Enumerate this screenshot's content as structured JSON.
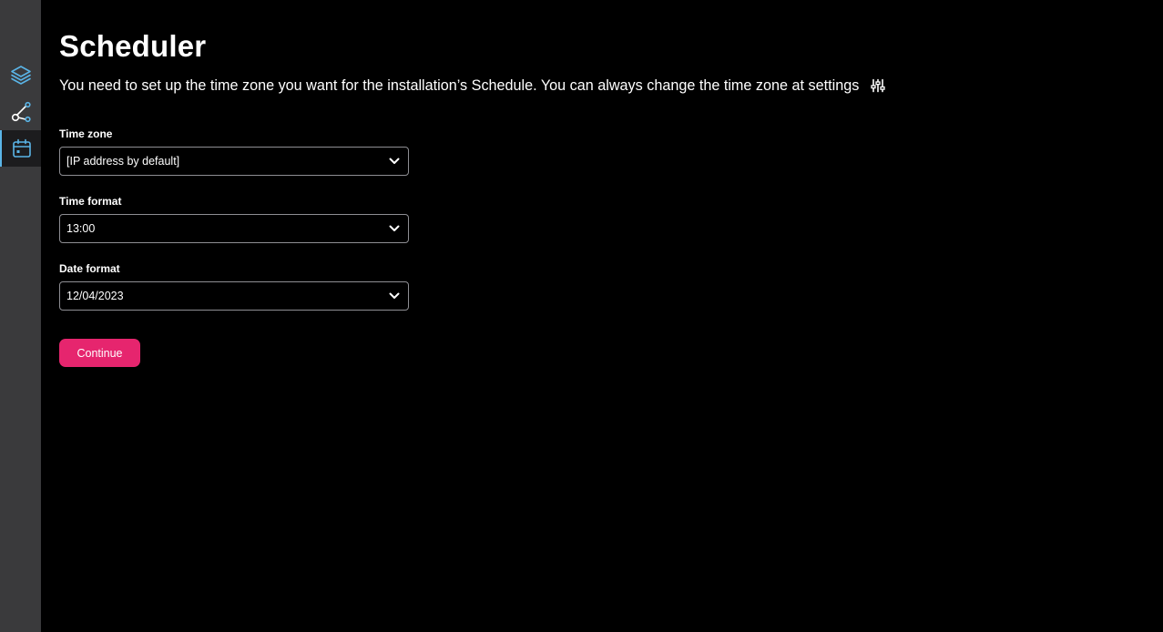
{
  "sidebar": {
    "items": [
      {
        "icon": "layers-icon",
        "active": false
      },
      {
        "icon": "workflow-nodes-icon",
        "active": false
      },
      {
        "icon": "calendar-icon",
        "active": true
      }
    ],
    "accent_color": "#5ab4e6"
  },
  "page": {
    "title": "Scheduler",
    "intro": "You need to set up the time zone you want for the installation’s Schedule. You can always change the time zone at settings",
    "settings_icon": "sliders-icon"
  },
  "form": {
    "time_zone": {
      "label": "Time zone",
      "value": "[IP address by default]"
    },
    "time_format": {
      "label": "Time format",
      "value": "13:00"
    },
    "date_format": {
      "label": "Date format",
      "value": "12/04/2023"
    }
  },
  "actions": {
    "continue_label": "Continue",
    "continue_color": "#e6256e"
  }
}
